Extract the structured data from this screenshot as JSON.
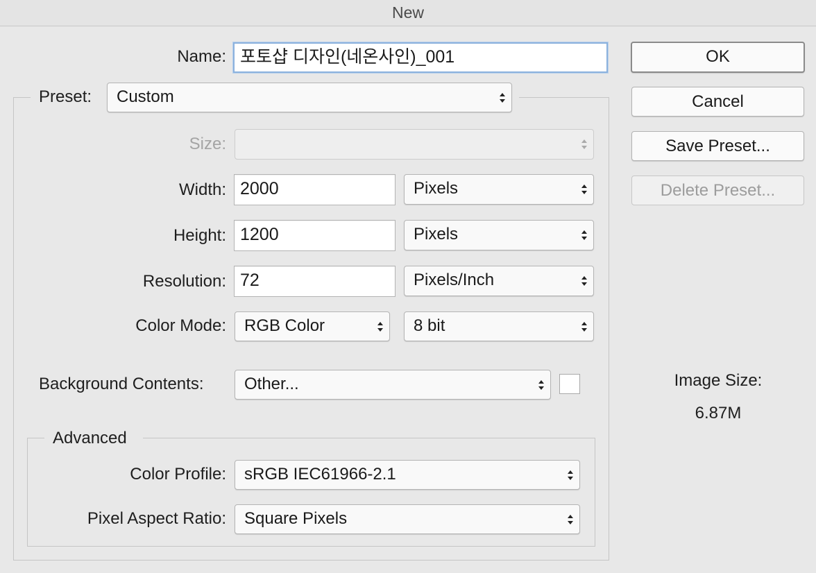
{
  "window": {
    "title": "New"
  },
  "name_field": {
    "label": "Name:",
    "value": "포토샵 디자인(네온사인)_001"
  },
  "preset": {
    "label": "Preset:",
    "value": "Custom"
  },
  "size": {
    "label": "Size:",
    "value": ""
  },
  "width": {
    "label": "Width:",
    "value": "2000",
    "unit": "Pixels"
  },
  "height": {
    "label": "Height:",
    "value": "1200",
    "unit": "Pixels"
  },
  "resolution": {
    "label": "Resolution:",
    "value": "72",
    "unit": "Pixels/Inch"
  },
  "color_mode": {
    "label": "Color Mode:",
    "mode": "RGB Color",
    "depth": "8 bit"
  },
  "background": {
    "label": "Background Contents:",
    "value": "Other...",
    "swatch_color": "#ffffff"
  },
  "advanced": {
    "title": "Advanced",
    "color_profile": {
      "label": "Color Profile:",
      "value": "sRGB IEC61966-2.1"
    },
    "pixel_aspect": {
      "label": "Pixel Aspect Ratio:",
      "value": "Square Pixels"
    }
  },
  "buttons": {
    "ok": "OK",
    "cancel": "Cancel",
    "save_preset": "Save Preset...",
    "delete_preset": "Delete Preset..."
  },
  "image_size": {
    "label": "Image Size:",
    "value": "6.87M"
  }
}
